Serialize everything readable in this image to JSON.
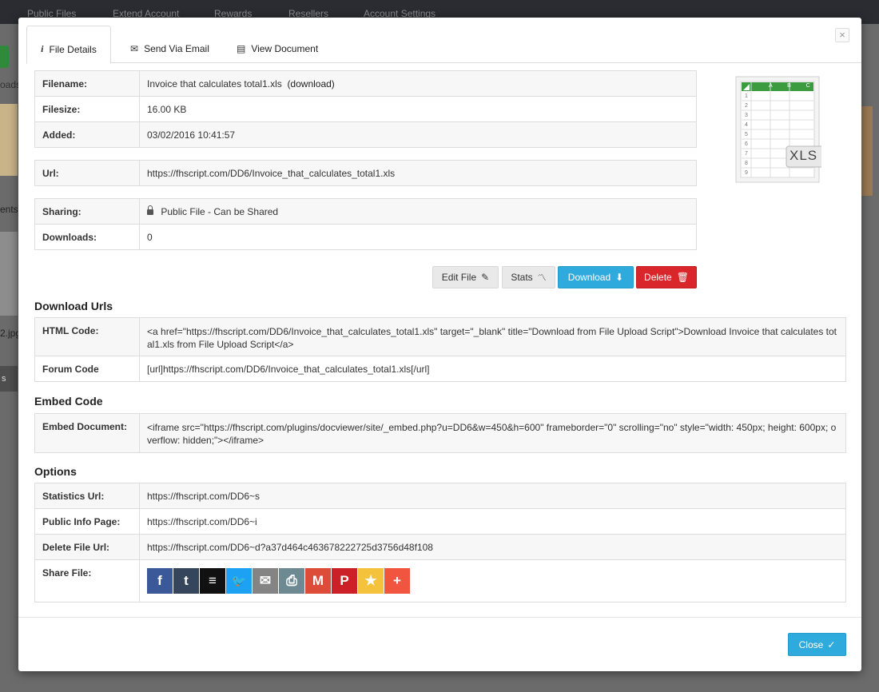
{
  "background": {
    "nav": [
      "Public Files",
      "Extend Account",
      "Rewards",
      "Resellers",
      "Account Settings"
    ],
    "frag_left_1": "oads",
    "frag_left_2": "ents",
    "frag_left_3": "2.jpg",
    "frag_left_4": "s"
  },
  "tabs": {
    "file_details": "File Details",
    "send_via_email": "Send Via Email",
    "view_document": "View Document"
  },
  "close_x": "×",
  "details": {
    "filename_label": "Filename:",
    "filename_value": "Invoice that calculates total1.xls",
    "download_link": "(download)",
    "filesize_label": "Filesize:",
    "filesize_value": "16.00 KB",
    "added_label": "Added:",
    "added_value": "03/02/2016 10:41:57",
    "url_label": "Url:",
    "url_value": "https://fhscript.com/DD6/Invoice_that_calculates_total1.xls",
    "sharing_label": "Sharing:",
    "sharing_value": "Public File - Can be Shared",
    "downloads_label": "Downloads:",
    "downloads_value": "0"
  },
  "file_icon": {
    "columns": [
      "A",
      "B",
      "C"
    ],
    "rows": [
      "1",
      "2",
      "3",
      "4",
      "5",
      "6",
      "7",
      "8",
      "9"
    ],
    "badge": "XLS"
  },
  "actions": {
    "edit": "Edit File",
    "stats": "Stats",
    "download": "Download",
    "delete": "Delete"
  },
  "download_urls": {
    "heading": "Download Urls",
    "html_label": "HTML Code:",
    "html_value": "<a href=\"https://fhscript.com/DD6/Invoice_that_calculates_total1.xls\" target=\"_blank\" title=\"Download from File Upload Script\">Download Invoice that calculates total1.xls from File Upload Script</a>",
    "forum_label": "Forum Code",
    "forum_value": "[url]https://fhscript.com/DD6/Invoice_that_calculates_total1.xls[/url]"
  },
  "embed": {
    "heading": "Embed Code",
    "label": "Embed Document:",
    "value": "<iframe src=\"https://fhscript.com/plugins/docviewer/site/_embed.php?u=DD6&w=450&h=600\" frameborder=\"0\" scrolling=\"no\" style=\"width: 450px; height: 600px; overflow: hidden;\"></iframe>"
  },
  "options": {
    "heading": "Options",
    "stats_label": "Statistics Url:",
    "stats_value": "https://fhscript.com/DD6~s",
    "info_label": "Public Info Page:",
    "info_value": "https://fhscript.com/DD6~i",
    "delete_label": "Delete File Url:",
    "delete_value": "https://fhscript.com/DD6~d?a37d464c463678222725d3756d48f108",
    "share_label": "Share File:"
  },
  "share_buttons": [
    {
      "name": "facebook",
      "glyph": "f",
      "color": "#3b5998"
    },
    {
      "name": "tumblr",
      "glyph": "t",
      "color": "#35465c"
    },
    {
      "name": "buffer",
      "glyph": "≡",
      "color": "#111111"
    },
    {
      "name": "twitter",
      "glyph": "🐦",
      "color": "#1da1f2"
    },
    {
      "name": "email",
      "glyph": "✉",
      "color": "#848484"
    },
    {
      "name": "print",
      "glyph": "⎙",
      "color": "#6d8a93"
    },
    {
      "name": "gmail",
      "glyph": "M",
      "color": "#dd4b39"
    },
    {
      "name": "pinterest",
      "glyph": "P",
      "color": "#cb2027"
    },
    {
      "name": "favorites",
      "glyph": "★",
      "color": "#f5c33b"
    },
    {
      "name": "more",
      "glyph": "+",
      "color": "#f1543f"
    }
  ],
  "footer": {
    "close": "Close"
  }
}
